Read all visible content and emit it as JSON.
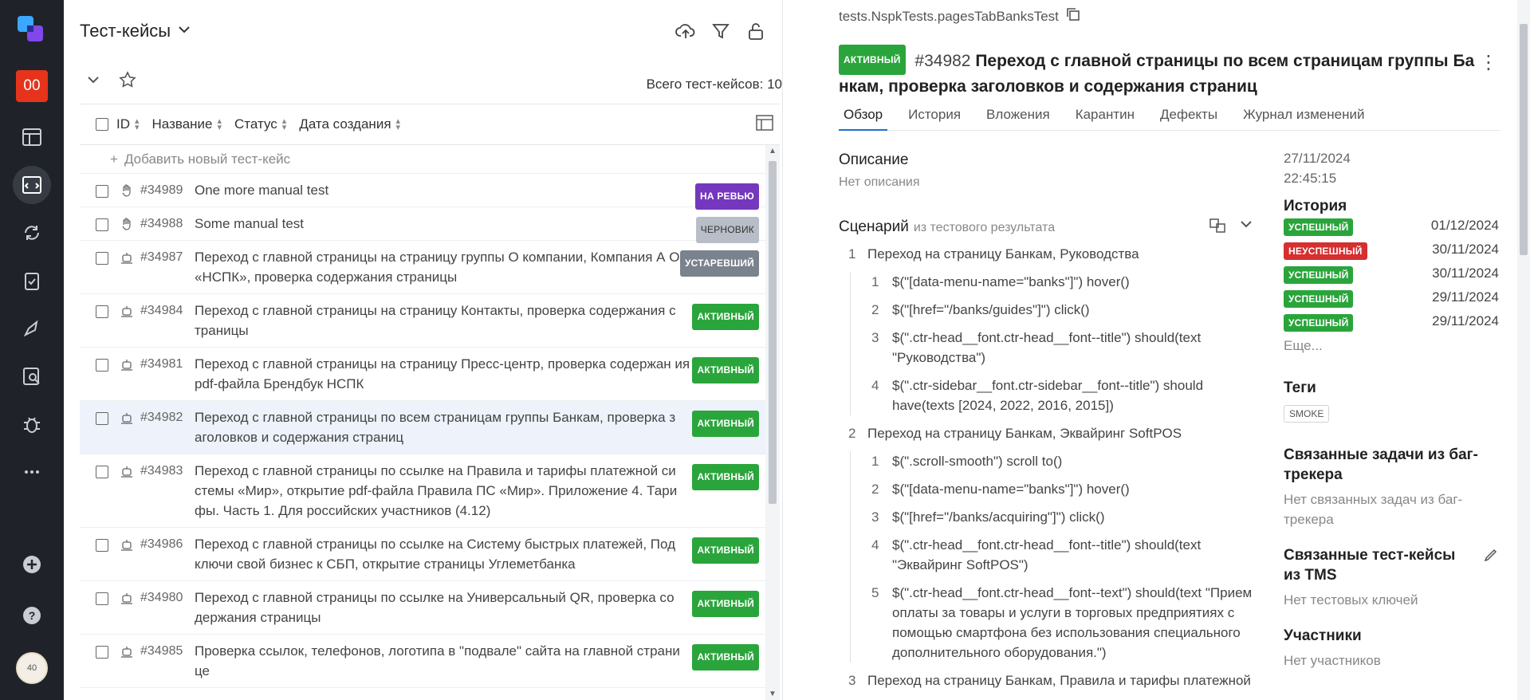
{
  "rail": {
    "project_badge": "00",
    "avatar_text": "40",
    "icons": [
      "logo-icon",
      "dashboard-icon",
      "testcases-icon",
      "launches-icon",
      "clipboard-icon",
      "rocket-icon",
      "search-report-icon",
      "bug-icon",
      "more-icon",
      "add-icon",
      "help-icon"
    ]
  },
  "list": {
    "title": "Тест-кейсы",
    "total_label": "Всего тест-кейсов: 10",
    "columns": [
      "ID",
      "Название",
      "Статус",
      "Дата создания"
    ],
    "add_new": "Добавить новый тест-кейс",
    "rows": [
      {
        "id": "#34989",
        "title": "One more manual test",
        "status": "НА РЕВЬЮ",
        "type": "manual"
      },
      {
        "id": "#34988",
        "title": "Some manual test",
        "status": "ЧЕРНОВИК",
        "type": "manual"
      },
      {
        "id": "#34987",
        "title": "Переход с главной страницы на страницу группы О компании, Компания А О «НСПК», проверка содержания страницы",
        "status": "УСТАРЕВШИЙ",
        "type": "auto"
      },
      {
        "id": "#34984",
        "title": "Переход с главной страницы на страницу Контакты, проверка содержания с траницы",
        "status": "АКТИВНЫЙ",
        "type": "auto"
      },
      {
        "id": "#34981",
        "title": "Переход с главной страницы на страницу Пресс-центр, проверка содержан ия pdf-файла Брендбук НСПК",
        "status": "АКТИВНЫЙ",
        "type": "auto"
      },
      {
        "id": "#34982",
        "title": "Переход с главной страницы по всем страницам группы Банкам, проверка з аголовков и содержания страниц",
        "status": "АКТИВНЫЙ",
        "type": "auto"
      },
      {
        "id": "#34983",
        "title": "Переход с главной страницы по ссылке на Правила и тарифы платежной си стемы «Мир», открытие pdf-файла Правила ПС «Мир». Приложение 4. Тари фы. Часть 1. Для российских участников (4.12)",
        "status": "АКТИВНЫЙ",
        "type": "auto"
      },
      {
        "id": "#34986",
        "title": "Переход с главной страницы по ссылке на Систему быстрых платежей, Под ключи свой бизнес к СБП, открытие страницы Углеметбанка",
        "status": "АКТИВНЫЙ",
        "type": "auto"
      },
      {
        "id": "#34980",
        "title": "Переход с главной страницы по ссылке на Универсальный QR, проверка со держания страницы",
        "status": "АКТИВНЫЙ",
        "type": "auto"
      },
      {
        "id": "#34985",
        "title": "Проверка ссылок, телефонов, логотипа в \"подвале\" сайта на главной страни це",
        "status": "АКТИВНЫЙ",
        "type": "auto"
      }
    ]
  },
  "detail": {
    "path": "tests.NspkTests.pagesTabBanksTest",
    "status": "АКТИВНЫЙ",
    "number": "#34982",
    "title": "Переход с главной страницы по всем страницам группы Ба нкам, проверка заголовков и содержания страниц",
    "tabs": [
      "Обзор",
      "История",
      "Вложения",
      "Карантин",
      "Дефекты",
      "Журнал изменений"
    ],
    "description_title": "Описание",
    "description_value": "Нет описания",
    "scenario_title": "Сценарий",
    "scenario_sub": "из тестового результата",
    "steps": [
      {
        "n": "1",
        "text": "Переход на страницу Банкам, Руководства",
        "children": [
          {
            "n": "1",
            "text": "$(\"[data-menu-name=\"banks\"]\") hover()"
          },
          {
            "n": "2",
            "text": "$(\"[href=\"/banks/guides\"]\") click()"
          },
          {
            "n": "3",
            "text": "$(\".ctr-head__font.ctr-head__font--title\") should(text \"Руководства\")"
          },
          {
            "n": "4",
            "text": "$(\".ctr-sidebar__font.ctr-sidebar__font--title\") should have(texts [2024, 2022, 2016, 2015])"
          }
        ]
      },
      {
        "n": "2",
        "text": "Переход на страницу Банкам, Эквайринг SoftPOS",
        "children": [
          {
            "n": "1",
            "text": "$(\".scroll-smooth\") scroll to()"
          },
          {
            "n": "2",
            "text": "$(\"[data-menu-name=\"banks\"]\") hover()"
          },
          {
            "n": "3",
            "text": "$(\"[href=\"/banks/acquiring\"]\") click()"
          },
          {
            "n": "4",
            "text": "$(\".ctr-head__font.ctr-head__font--title\") should(text \"Эквайринг SoftPOS\")"
          },
          {
            "n": "5",
            "text": "$(\".ctr-head__font.ctr-head__font--text\") should(text \"Прием оплаты за товары и услуги в торговых предприятиях с помощью смартфона без использования специального дополнительного оборудования.\")"
          }
        ]
      },
      {
        "n": "3",
        "text": "Переход на страницу Банкам, Правила и тарифы платежной",
        "children": []
      }
    ],
    "side": {
      "created_date": "27/11/2024",
      "created_time": "22:45:15",
      "history_title": "История",
      "history": [
        {
          "status": "УСПЕШНЫЙ",
          "date": "01/12/2024"
        },
        {
          "status": "НЕУСПЕШНЫЙ",
          "date": "30/11/2024"
        },
        {
          "status": "УСПЕШНЫЙ",
          "date": "30/11/2024"
        },
        {
          "status": "УСПЕШНЫЙ",
          "date": "29/11/2024"
        },
        {
          "status": "УСПЕШНЫЙ",
          "date": "29/11/2024"
        }
      ],
      "more": "Еще...",
      "tags_title": "Теги",
      "tag": "SMOKE",
      "issues_title": "Связанные задачи из баг-трекера",
      "issues_value": "Нет связанных задач из баг-трекера",
      "tms_title": "Связанные тест-кейсы из TMS",
      "tms_value": "Нет тестовых ключей",
      "members_title": "Участники",
      "members_value": "Нет участников"
    }
  },
  "colors": {
    "active": "#2aa53b",
    "review": "#7437bd",
    "draft": "#b8bec7",
    "outdated": "#7a828d",
    "failed": "#d52f2f",
    "rail": "#1f2329",
    "accent": "#e5341b"
  }
}
